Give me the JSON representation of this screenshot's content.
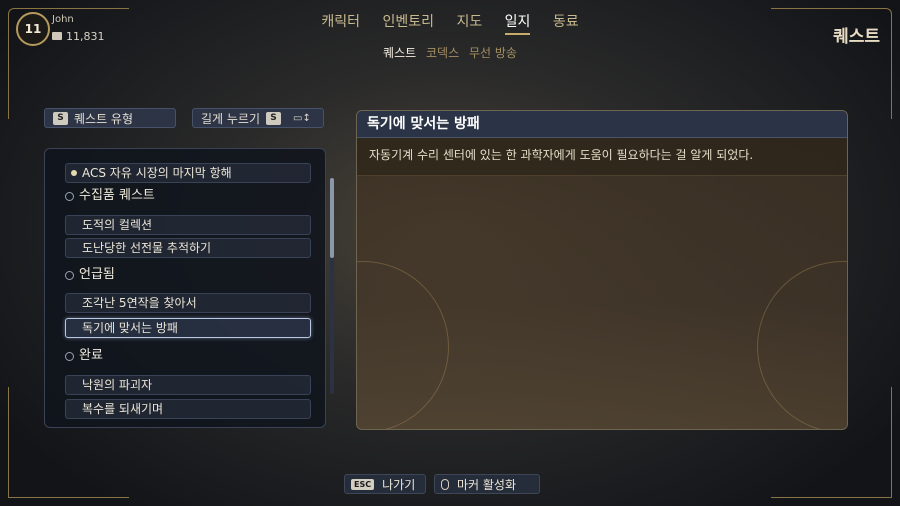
{
  "player": {
    "level": "11",
    "name": "John",
    "credits": "11,831",
    "credit_icon": "credits-icon"
  },
  "nav": {
    "tabs": [
      "캐릭터",
      "인벤토리",
      "지도",
      "일지",
      "동료"
    ],
    "active": "일지"
  },
  "subnav": {
    "tabs": [
      "퀘스트",
      "코덱스",
      "무선 방송"
    ],
    "active": "퀘스트"
  },
  "page_title": "퀘스트",
  "filters": {
    "type": {
      "key": "S",
      "label": "퀘스트 유형"
    },
    "hold": {
      "label": "길게 누르기",
      "key": "S",
      "icon": "sort-icon"
    }
  },
  "quest_list": {
    "top_item": "ACS 자유 시장의 마지막 항해",
    "sections": [
      {
        "header": "수집품 퀘스트",
        "items": [
          "도적의 컬렉션",
          "도난당한 선전물 추적하기"
        ]
      },
      {
        "header": "언급됨",
        "items": [
          "조각난 5연작을 찾아서",
          "독기에 맞서는 방패"
        ]
      },
      {
        "header": "완료",
        "items": [
          "낙원의 파괴자",
          "복수를 되새기며"
        ]
      }
    ],
    "selected": "독기에 맞서는 방패"
  },
  "detail": {
    "title": "독기에 맞서는 방패",
    "description": "자동기계 수리 센터에 있는 한 과학자에게 도움이 필요하다는 걸 알게 되었다."
  },
  "hints": {
    "back": {
      "key": "ESC",
      "label": "나가기"
    },
    "marker": {
      "icon": "mouse-icon",
      "label": "마커 활성화"
    }
  },
  "colors": {
    "accent_gold": "#c9ab6a",
    "panel_blue": "#2b3446",
    "selected_border": "#b8c8e4"
  }
}
